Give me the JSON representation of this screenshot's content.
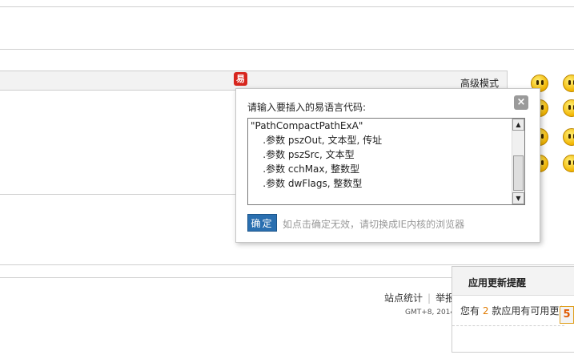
{
  "editor": {
    "advanced_mode_label": "高级模式",
    "insert_code_icon_glyph": "易"
  },
  "dialog": {
    "title": "请输入要插入的易语言代码:",
    "close_glyph": "×",
    "code_lines": [
      "\"PathCompactPathExA\"",
      "    .参数 pszOut, 文本型, 传址",
      "    .参数 pszSrc, 文本型",
      "    .参数 cchMax, 整数型",
      "    .参数 dwFlags, 整数型"
    ],
    "ok_label": "确定",
    "hint": "如点击确定无效，请切换成IE内核的浏览器",
    "scroll_up_glyph": "▲",
    "scroll_down_glyph": "▼"
  },
  "footer": {
    "links": [
      "站点统计",
      "举报"
    ],
    "timezone_text": "GMT+8, 2014"
  },
  "notice": {
    "title": "应用更新提醒",
    "text_prefix": "您有",
    "count": "2",
    "text_suffix": "款应用有可用更新",
    "badge_glyph": "5"
  },
  "colors": {
    "accent_button": "#2a6fb0",
    "count_highlight": "#e07a00",
    "editor_icon": "#d7261e"
  }
}
